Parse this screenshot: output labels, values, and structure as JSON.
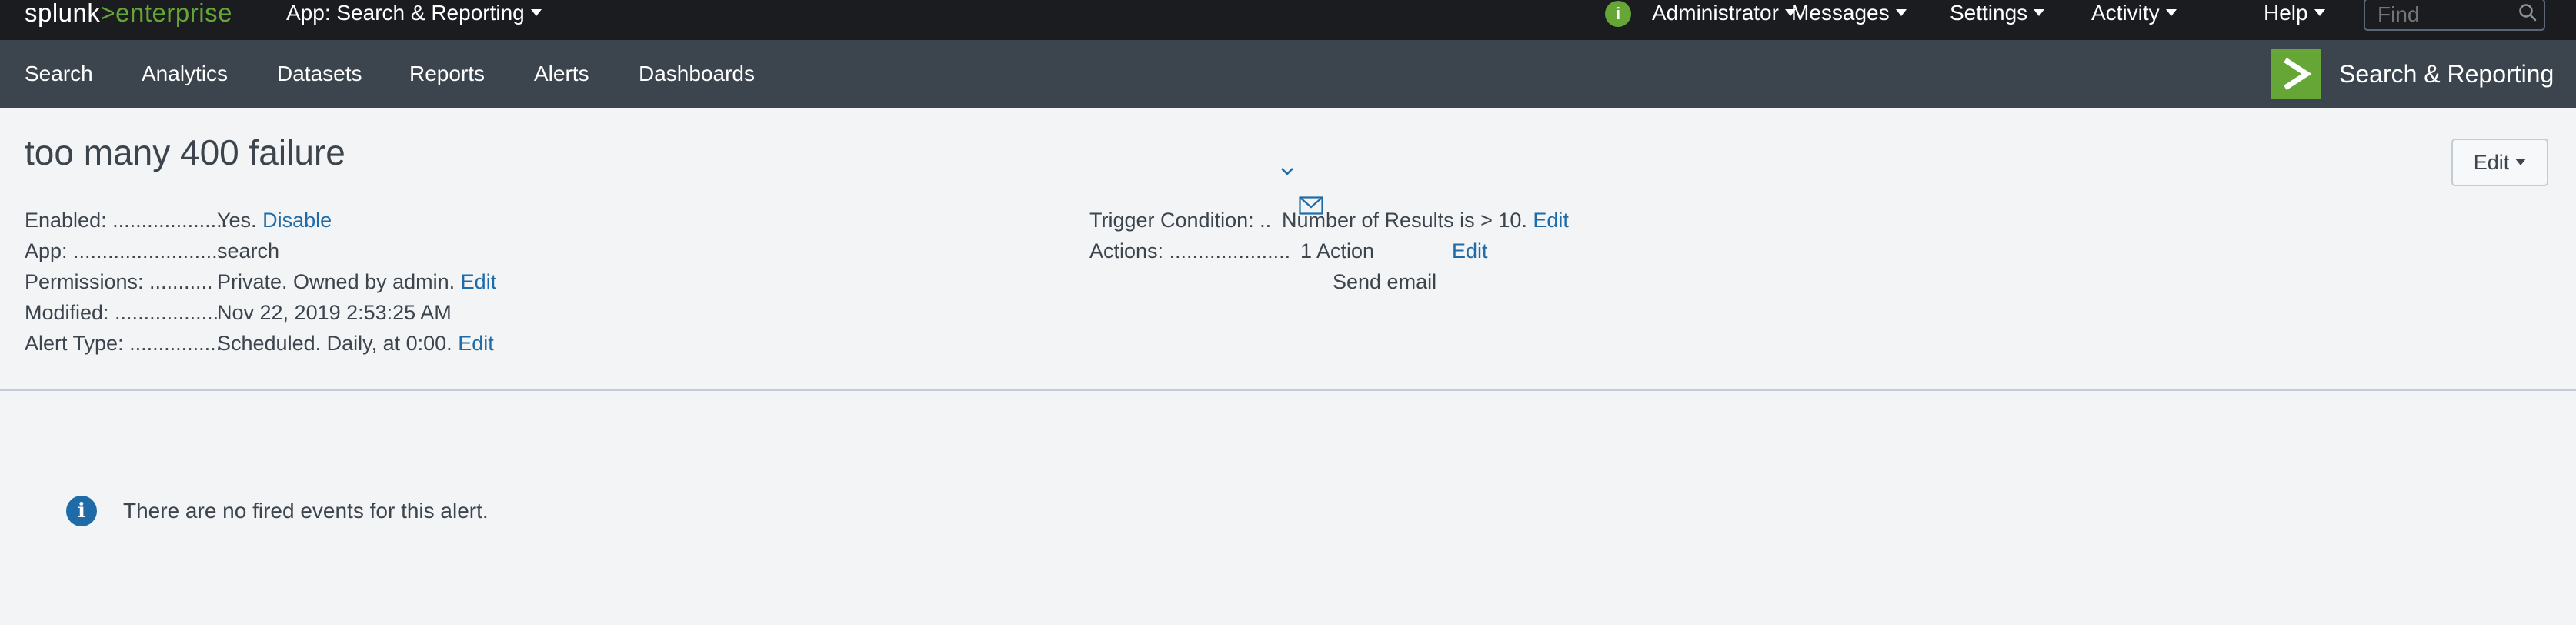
{
  "topbar": {
    "logo_main": "splunk",
    "logo_gt": ">",
    "logo_product": "enterprise",
    "app_menu": "App: Search & Reporting",
    "menus": [
      "Administrator",
      "Messages",
      "Settings",
      "Activity",
      "Help"
    ],
    "find_placeholder": "Find"
  },
  "appbar": {
    "nav": [
      "Search",
      "Analytics",
      "Datasets",
      "Reports",
      "Alerts",
      "Dashboards"
    ],
    "brand_title": "Search & Reporting"
  },
  "alert": {
    "title": "too many 400 failure",
    "edit_button": "Edit",
    "left_fields": [
      {
        "label": "Enabled: ....................",
        "value": "Yes.",
        "link": "Disable"
      },
      {
        "label": "App: ..........................",
        "value": "search",
        "link": ""
      },
      {
        "label": "Permissions: ...........",
        "value": "Private. Owned by admin.",
        "link": "Edit"
      },
      {
        "label": "Modified: ..................",
        "value": "Nov 22, 2019 2:53:25 AM",
        "link": ""
      },
      {
        "label": "Alert Type: ................",
        "value": "Scheduled. Daily, at 0:00.",
        "link": "Edit"
      }
    ],
    "trigger_label": "Trigger Condition: ..",
    "trigger_value": "Number of Results is > 10.",
    "trigger_link": "Edit",
    "actions_label": "Actions: .....................",
    "actions_value": "1 Action",
    "actions_link": "Edit",
    "action_item": "Send email"
  },
  "empty_message": "There are no fired events for this alert.",
  "colors": {
    "accent": "#65a637",
    "link": "#1e6ba8",
    "dark": "#1a1c20",
    "nav": "#3c444d"
  }
}
